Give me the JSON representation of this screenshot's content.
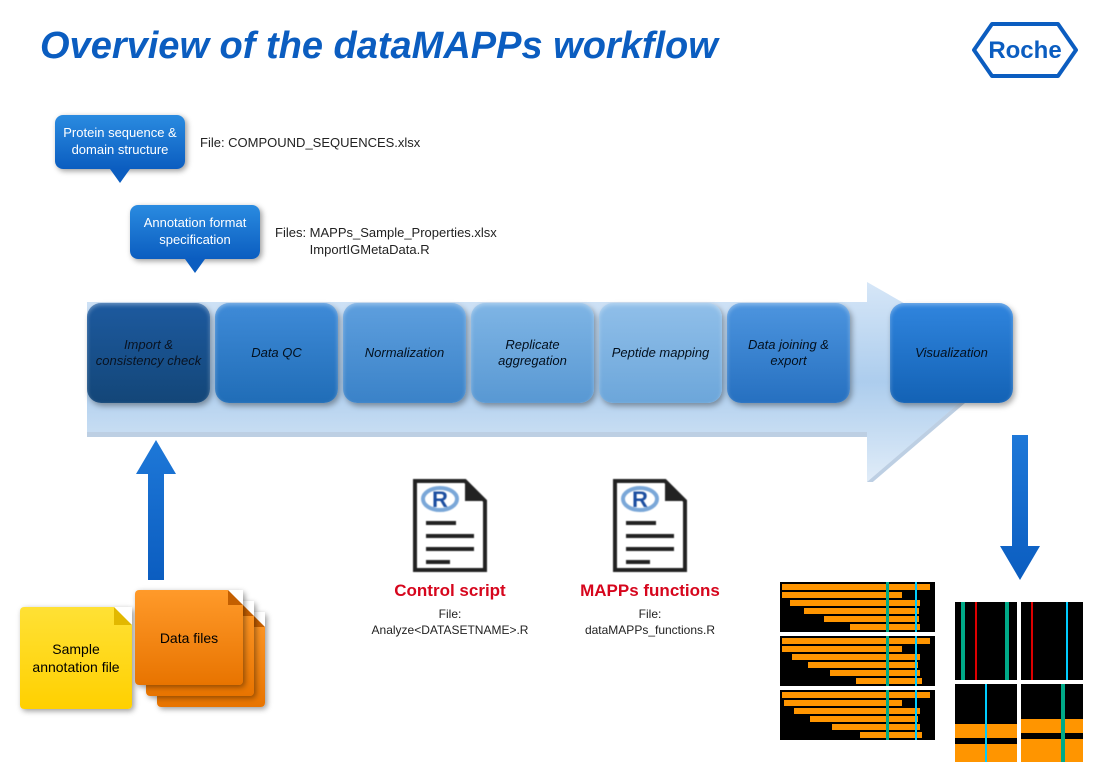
{
  "title": "Overview of the dataMAPPs workflow",
  "brand": "Roche",
  "inputs": {
    "protein_box": "Protein sequence & domain structure",
    "protein_file_prefix": "File: ",
    "protein_file": "COMPOUND_SEQUENCES.xlsx",
    "annotation_box": "Annotation format specification",
    "annotation_file_prefix": "Files: ",
    "annotation_file1": "MAPPs_Sample_Properties.xlsx",
    "annotation_file2": "ImportIGMetaData.R"
  },
  "steps": [
    "Import & consistency check",
    "Data QC",
    "Normalization",
    "Replicate aggregation",
    "Peptide mapping",
    "Data joining & export",
    "Visualization"
  ],
  "bottom_left": {
    "sample_annotation": "Sample annotation file",
    "data_files": "Data files"
  },
  "scripts": {
    "control_title": "Control script",
    "control_file_label": "File:",
    "control_file": "Analyze<DATASETNAME>.R",
    "mapps_title": "MAPPs functions",
    "mapps_file_label": "File:",
    "mapps_file": "dataMAPPs_functions.R"
  },
  "colors": {
    "title_blue": "#0b5dc0",
    "accent_red": "#d6061d"
  }
}
